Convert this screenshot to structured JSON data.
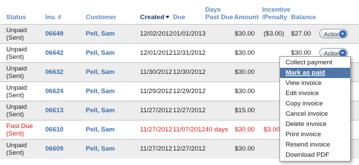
{
  "table": {
    "headers": {
      "status": "Status",
      "invoice": "Inv. #",
      "customer": "Customer",
      "created": "Created",
      "due": "Due",
      "days_past_due_1": "Days",
      "days_past_due_2": "Past Due",
      "amount": "Amount",
      "incentive_1": "Incentive",
      "incentive_2": "/Penalty",
      "balance": "Balance"
    },
    "rows": [
      {
        "status1": "Unpaid",
        "status2": "(Sent)",
        "inv": "06649",
        "customer": "Pell, Sam",
        "created": "12/02/2012",
        "due": "01/01/2013",
        "days": "",
        "amount": "$30.00",
        "incentive": "($3.00)",
        "balance": "$27.00",
        "action": "Action"
      },
      {
        "status1": "Unpaid",
        "status2": "(Sent)",
        "inv": "06642",
        "customer": "Pell, Sam",
        "created": "12/01/2012",
        "due": "12/31/2012",
        "days": "",
        "amount": "$30.00",
        "incentive": "",
        "balance": "$30.00",
        "action": "Action"
      },
      {
        "status1": "Unpaid",
        "status2": "(Sent)",
        "inv": "06632",
        "customer": "Pell, Sam",
        "created": "11/30/2012",
        "due": "12/30/2012",
        "days": "",
        "amount": "$30.00",
        "incentive": "",
        "balance": "",
        "action": ""
      },
      {
        "status1": "Unpaid",
        "status2": "(Sent)",
        "inv": "06624",
        "customer": "Pell, Sam",
        "created": "11/29/2012",
        "due": "12/29/2012",
        "days": "",
        "amount": "$30.00",
        "incentive": "",
        "balance": "",
        "action": ""
      },
      {
        "status1": "Unpaid",
        "status2": "(Sent)",
        "inv": "06613",
        "customer": "Pell, Sam",
        "created": "11/27/2012",
        "due": "12/27/2012",
        "days": "",
        "amount": "$15.00",
        "incentive": "",
        "balance": "",
        "action": ""
      },
      {
        "status1": "Past Due",
        "status2": "(Sent)",
        "inv": "06610",
        "customer": "Pell, Sam",
        "created": "11/27/2012",
        "due": "11/07/2012",
        "days": "40 days",
        "amount": "$30.00",
        "incentive": "$3.00",
        "balance": "",
        "action": ""
      },
      {
        "status1": "Unpaid",
        "status2": "(Sent)",
        "inv": "06609",
        "customer": "Pell, Sam",
        "created": "11/27/2012",
        "due": "12/27/2012",
        "days": "",
        "amount": "$30.00",
        "incentive": "",
        "balance": "",
        "action": ""
      }
    ]
  },
  "action_menu": {
    "items": [
      "Collect payment",
      "Mark as paid",
      "View invoice",
      "Edit invoice",
      "Copy invoice",
      "Cancel invoice",
      "Delete invoice",
      "Print invoice",
      "Resend invoice",
      "Download PDF"
    ],
    "highlighted": "Mark as paid"
  },
  "colors": {
    "header": "#5d8ac0",
    "link": "#3d6fb0",
    "past_due": "#e01b1b",
    "menu_highlight": "#4e76a8",
    "row_alt": "#ededed"
  }
}
